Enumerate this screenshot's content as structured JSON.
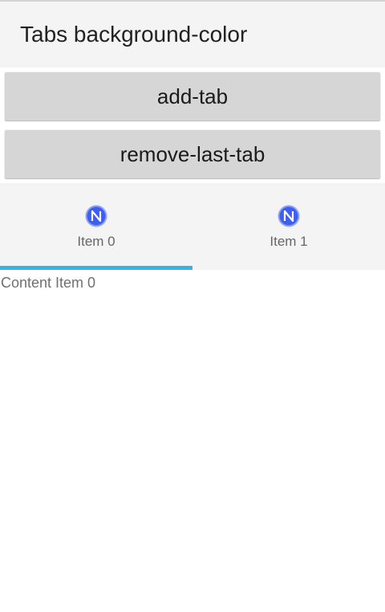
{
  "action_bar": {
    "title": "Tabs background-color"
  },
  "buttons": {
    "add_tab": "add-tab",
    "remove_last_tab": "remove-last-tab"
  },
  "tabs": [
    {
      "label": "Item 0",
      "icon": "nativescript-logo-icon",
      "selected": true
    },
    {
      "label": "Item 1",
      "icon": "nativescript-logo-icon",
      "selected": false
    }
  ],
  "content": {
    "text": "Content Item 0"
  },
  "colors": {
    "tab_strip_background": "#f4f4f4",
    "selected_tab_indicator": "#33b5e5",
    "button_background": "#d6d6d6",
    "icon_color": "#3f5eed"
  }
}
